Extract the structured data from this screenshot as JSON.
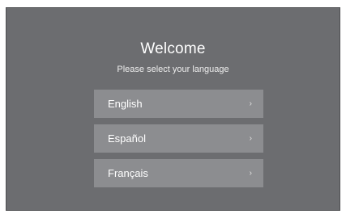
{
  "welcome": {
    "title": "Welcome",
    "subtitle": "Please select your language"
  },
  "languages": [
    {
      "label": "English",
      "icon": "chevron-right-icon",
      "glyph": "›"
    },
    {
      "label": "Español",
      "icon": "chevron-right-icon",
      "glyph": "›"
    },
    {
      "label": "Français",
      "icon": "chevron-right-icon",
      "glyph": "›"
    }
  ],
  "colors": {
    "screen_background": "#6c6d70",
    "button_background": "#8c8d90",
    "text": "#ffffff"
  }
}
